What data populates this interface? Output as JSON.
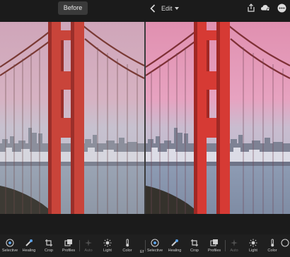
{
  "topbar": {
    "before_label": "Before",
    "edit_label": "Edit",
    "icons": [
      "back-chevron-icon",
      "share-icon",
      "cloud-sync-icon",
      "more-icon"
    ]
  },
  "toolbar": {
    "left": [
      "Selective",
      "Healing",
      "Crop",
      "Profiles",
      "Auto",
      "Light",
      "Color"
    ],
    "partial_label": "Ef",
    "right": [
      "Selective",
      "Healing",
      "Crop",
      "Profiles",
      "Auto",
      "Light",
      "Color"
    ],
    "disabled": [
      "Auto"
    ]
  },
  "colors": {
    "background": "#1b1b1b",
    "tower_before": "#c9443a",
    "tower_after": "#d63a34",
    "sky_before_top": "#d0a2b6",
    "sky_after_top": "#e58fb1"
  }
}
